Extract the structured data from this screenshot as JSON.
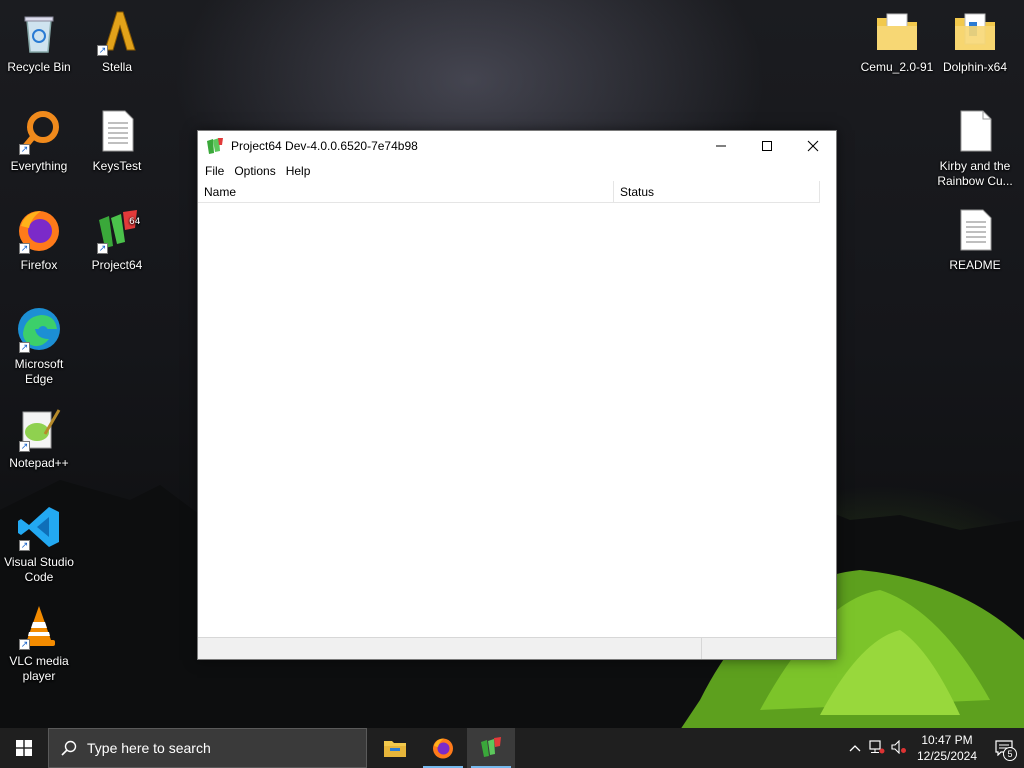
{
  "desktop": {
    "icons": [
      {
        "label": "Recycle Bin",
        "icon": "recycle-bin-icon"
      },
      {
        "label": "Stella",
        "icon": "stella-icon"
      },
      {
        "label": "Everything",
        "icon": "everything-icon"
      },
      {
        "label": "KeysTest",
        "icon": "text-file-icon"
      },
      {
        "label": "Firefox",
        "icon": "firefox-icon"
      },
      {
        "label": "Project64",
        "icon": "project64-icon"
      },
      {
        "label": "Microsoft Edge",
        "icon": "edge-icon"
      },
      {
        "label": "Notepad++",
        "icon": "notepadpp-icon"
      },
      {
        "label": "Visual Studio Code",
        "icon": "vscode-icon"
      },
      {
        "label": "VLC media player",
        "icon": "vlc-icon"
      },
      {
        "label": "Cemu_2.0-91",
        "icon": "folder-icon"
      },
      {
        "label": "Dolphin-x64",
        "icon": "folder-icon"
      },
      {
        "label": "Kirby and the Rainbow Cu...",
        "icon": "file-icon"
      },
      {
        "label": "README",
        "icon": "text-file-icon"
      }
    ]
  },
  "window": {
    "title": "Project64 Dev-4.0.0.6520-7e74b98",
    "menu": [
      "File",
      "Options",
      "Help"
    ],
    "columns": [
      "Name",
      "Status"
    ]
  },
  "taskbar": {
    "search_placeholder": "Type here to search",
    "time": "10:47 PM",
    "date": "12/25/2024",
    "notification_count": "5"
  },
  "colors": {
    "accent": "#76b9ed",
    "taskbar": "#1f1f1f"
  }
}
